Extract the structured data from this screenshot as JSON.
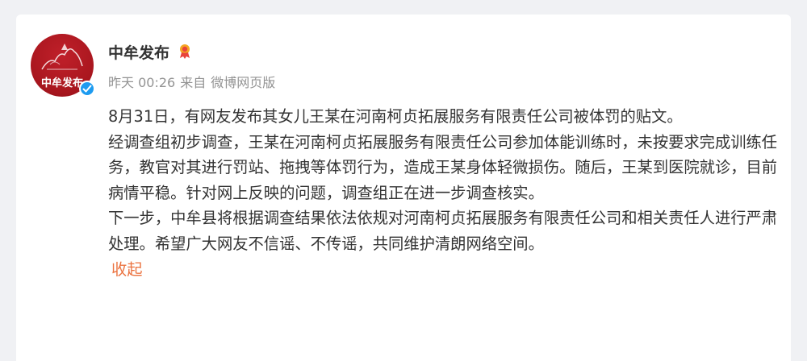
{
  "post": {
    "author_name": "中牟发布",
    "avatar_text": "中牟发布",
    "verified_badge": "verified-icon",
    "timestamp": "昨天 00:26",
    "source_prefix": "来自",
    "source": "微博网页版",
    "paragraphs": [
      "8月31日，有网友发布其女儿王某在河南柯贞拓展服务有限责任公司被体罚的贴文。",
      "经调查组初步调查，王某在河南柯贞拓展服务有限责任公司参加体能训练时，未按要求完成训练任务，教官对其进行罚站、拖拽等体罚行为，造成王某身体轻微损伤。随后，王某到医院就诊，目前病情平稳。针对网上反映的问题，调查组正在进一步调查核实。",
      "下一步，中牟县将根据调查结果依法依规对河南柯贞拓展服务有限责任公司和相关责任人进行严肃处理。希望广大网友不信谣、不传谣，共同维护清朗网络空间。"
    ],
    "collapse_label": "收起"
  },
  "colors": {
    "background": "#f0f1f4",
    "card": "#ffffff",
    "text": "#333333",
    "meta": "#939393",
    "link": "#eb7340",
    "avatar_red": "#a8161e",
    "verified_blue": "#1d9bf0"
  }
}
